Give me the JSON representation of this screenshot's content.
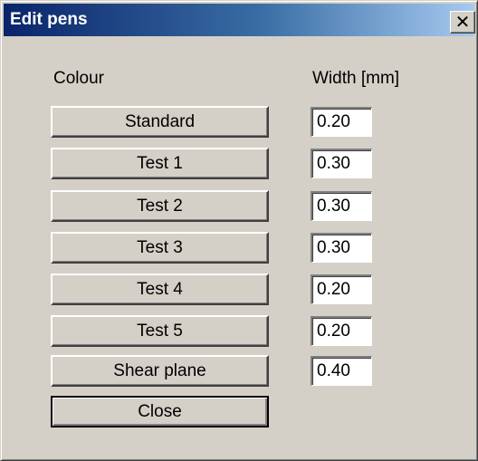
{
  "window": {
    "title": "Edit pens",
    "close_glyph": "✕"
  },
  "headers": {
    "colour": "Colour",
    "width": "Width [mm]"
  },
  "pens": [
    {
      "label": "Standard",
      "width": "0.20"
    },
    {
      "label": "Test 1",
      "width": "0.30"
    },
    {
      "label": "Test 2",
      "width": "0.30"
    },
    {
      "label": "Test 3",
      "width": "0.30"
    },
    {
      "label": "Test 4",
      "width": "0.20"
    },
    {
      "label": "Test 5",
      "width": "0.20"
    },
    {
      "label": "Shear plane",
      "width": "0.40"
    }
  ],
  "buttons": {
    "close_label": "Close"
  },
  "colors": {
    "face": "#d4d0c8",
    "title_start": "#0a246a",
    "title_end": "#a6caf0"
  }
}
